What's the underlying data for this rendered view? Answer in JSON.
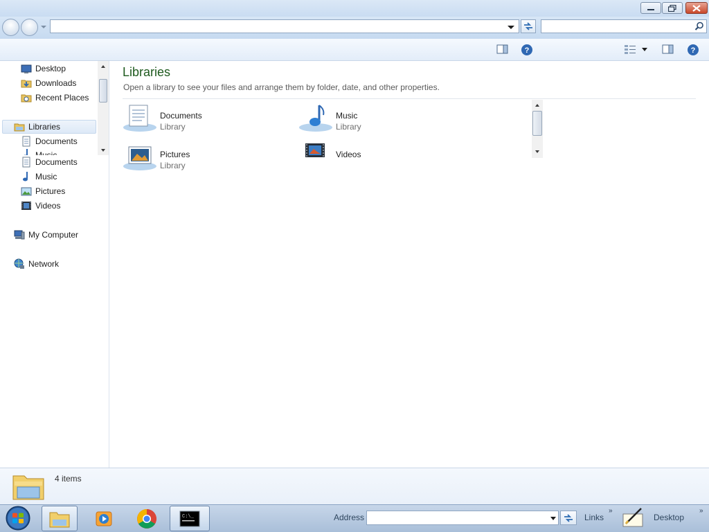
{
  "window": {
    "minimize_icon": "minimize-icon",
    "maximize_icon": "restore-icon",
    "close_icon": "close-icon"
  },
  "address_bar": {
    "value": "",
    "placeholder": ""
  },
  "search": {
    "value": "",
    "placeholder": ""
  },
  "nav_pane": {
    "favorites": [
      {
        "label": "Desktop",
        "icon": "desktop-icon"
      },
      {
        "label": "Downloads",
        "icon": "downloads-icon"
      },
      {
        "label": "Recent Places",
        "icon": "recent-places-icon"
      }
    ],
    "libraries": {
      "label": "Libraries",
      "icon": "libraries-icon"
    },
    "library_children": [
      {
        "label": "Documents",
        "icon": "documents-icon"
      },
      {
        "label": "Music",
        "icon": "music-icon"
      },
      {
        "label": "Documents",
        "icon": "documents-icon"
      },
      {
        "label": "Music",
        "icon": "music-icon"
      },
      {
        "label": "Pictures",
        "icon": "pictures-icon"
      },
      {
        "label": "Videos",
        "icon": "videos-icon"
      }
    ],
    "computer": {
      "label": "My Computer",
      "icon": "computer-icon"
    },
    "network": {
      "label": "Network",
      "icon": "network-icon"
    }
  },
  "content": {
    "title": "Libraries",
    "subtitle": "Open a library to see your files and arrange them by folder, date, and other properties.",
    "items": [
      {
        "name": "Documents",
        "type": "Library",
        "icon": "documents-library-icon"
      },
      {
        "name": "Music",
        "type": "Library",
        "icon": "music-library-icon"
      },
      {
        "name": "Pictures",
        "type": "Library",
        "icon": "pictures-library-icon"
      },
      {
        "name": "Videos",
        "type": "",
        "icon": "videos-library-icon"
      }
    ]
  },
  "details": {
    "count": "4 items"
  },
  "taskbar": {
    "address_label": "Address",
    "address_value": "",
    "links_label": "Links",
    "desktop_label": "Desktop",
    "chevron": "»"
  }
}
